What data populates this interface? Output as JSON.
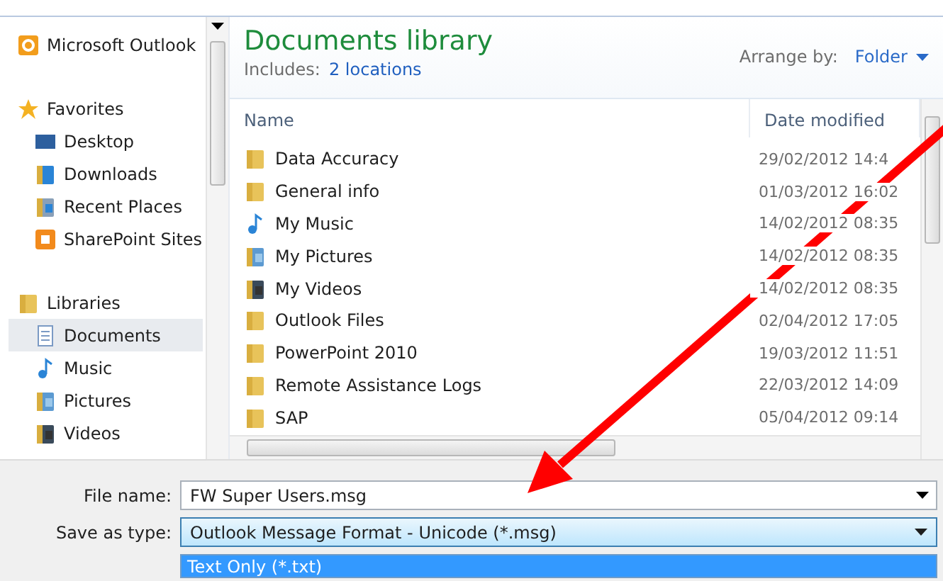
{
  "sidebar": {
    "top": {
      "label": "Microsoft Outlook"
    },
    "groups": [
      {
        "label": "Favorites",
        "items": [
          {
            "label": "Desktop",
            "selected": false
          },
          {
            "label": "Downloads",
            "selected": false
          },
          {
            "label": "Recent Places",
            "selected": false
          },
          {
            "label": "SharePoint Sites",
            "selected": false
          }
        ]
      },
      {
        "label": "Libraries",
        "items": [
          {
            "label": "Documents",
            "selected": true
          },
          {
            "label": "Music",
            "selected": false
          },
          {
            "label": "Pictures",
            "selected": false
          },
          {
            "label": "Videos",
            "selected": false
          }
        ]
      }
    ]
  },
  "library": {
    "title": "Documents library",
    "includes_label": "Includes:",
    "includes_link": "2 locations",
    "arrange_label": "Arrange by:",
    "arrange_value": "Folder"
  },
  "table": {
    "columns": [
      "Name",
      "Date modified"
    ],
    "rows": [
      {
        "name": "Data Accuracy",
        "date": "29/02/2012 14:4",
        "kind": "folder"
      },
      {
        "name": "General info",
        "date": "01/03/2012 16:02",
        "kind": "folder"
      },
      {
        "name": "My Music",
        "date": "14/02/2012 08:35",
        "kind": "music"
      },
      {
        "name": "My Pictures",
        "date": "14/02/2012 08:35",
        "kind": "pictures"
      },
      {
        "name": "My Videos",
        "date": "14/02/2012 08:35",
        "kind": "videos"
      },
      {
        "name": "Outlook Files",
        "date": "02/04/2012 17:05",
        "kind": "folder"
      },
      {
        "name": "PowerPoint 2010",
        "date": "19/03/2012 11:51",
        "kind": "folder"
      },
      {
        "name": "Remote Assistance Logs",
        "date": "22/03/2012 14:09",
        "kind": "folder"
      },
      {
        "name": "SAP",
        "date": "05/04/2012 09:14",
        "kind": "folder"
      }
    ]
  },
  "form": {
    "file_name_label": "File name:",
    "file_name": "FW Super Users.msg",
    "type_label": "Save as type:",
    "type_value": "Outlook Message Format - Unicode (*.msg)",
    "type_options": [
      {
        "label": "Text Only (*.txt)",
        "selected": true
      }
    ]
  }
}
